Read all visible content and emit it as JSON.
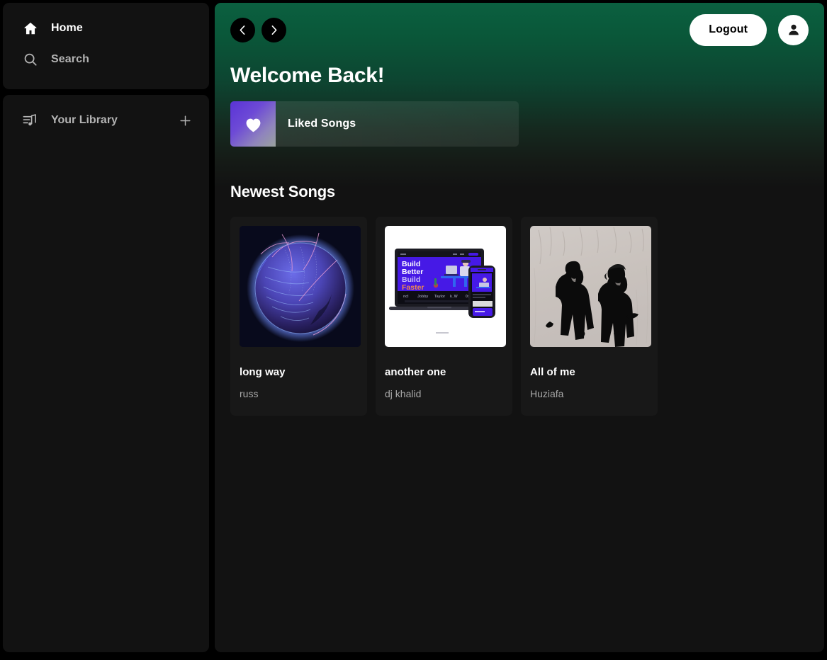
{
  "sidebar": {
    "nav": [
      {
        "label": "Home",
        "icon": "home-icon",
        "active": true
      },
      {
        "label": "Search",
        "icon": "search-icon",
        "active": false
      }
    ],
    "library": {
      "label": "Your Library",
      "icon": "library-icon",
      "add_label": "+"
    }
  },
  "topbar": {
    "back_icon": "chevron-left-icon",
    "forward_icon": "chevron-right-icon",
    "logout_label": "Logout",
    "avatar_icon": "user-icon"
  },
  "main": {
    "page_title": "Welcome Back!",
    "liked": {
      "label": "Liked Songs",
      "icon": "heart-icon"
    },
    "section_title": "Newest Songs",
    "songs": [
      {
        "title": "long way",
        "artist": "russ",
        "art": "globe-network-art"
      },
      {
        "title": "another one",
        "artist": "dj khalid",
        "art": "laptop-mockup-art"
      },
      {
        "title": "All of me",
        "artist": "Huziafa",
        "art": "two-people-bw-photo-art"
      }
    ]
  },
  "artwork_text": {
    "build_line1": "Build",
    "build_line2": "Better",
    "build_line3": "Build",
    "build_line4": "Faster"
  },
  "colors": {
    "accent_green": "#0b6040",
    "panel": "#121212",
    "card": "#181818",
    "liked_purple": "#5a33d6",
    "text_muted": "#a7a7a7"
  }
}
